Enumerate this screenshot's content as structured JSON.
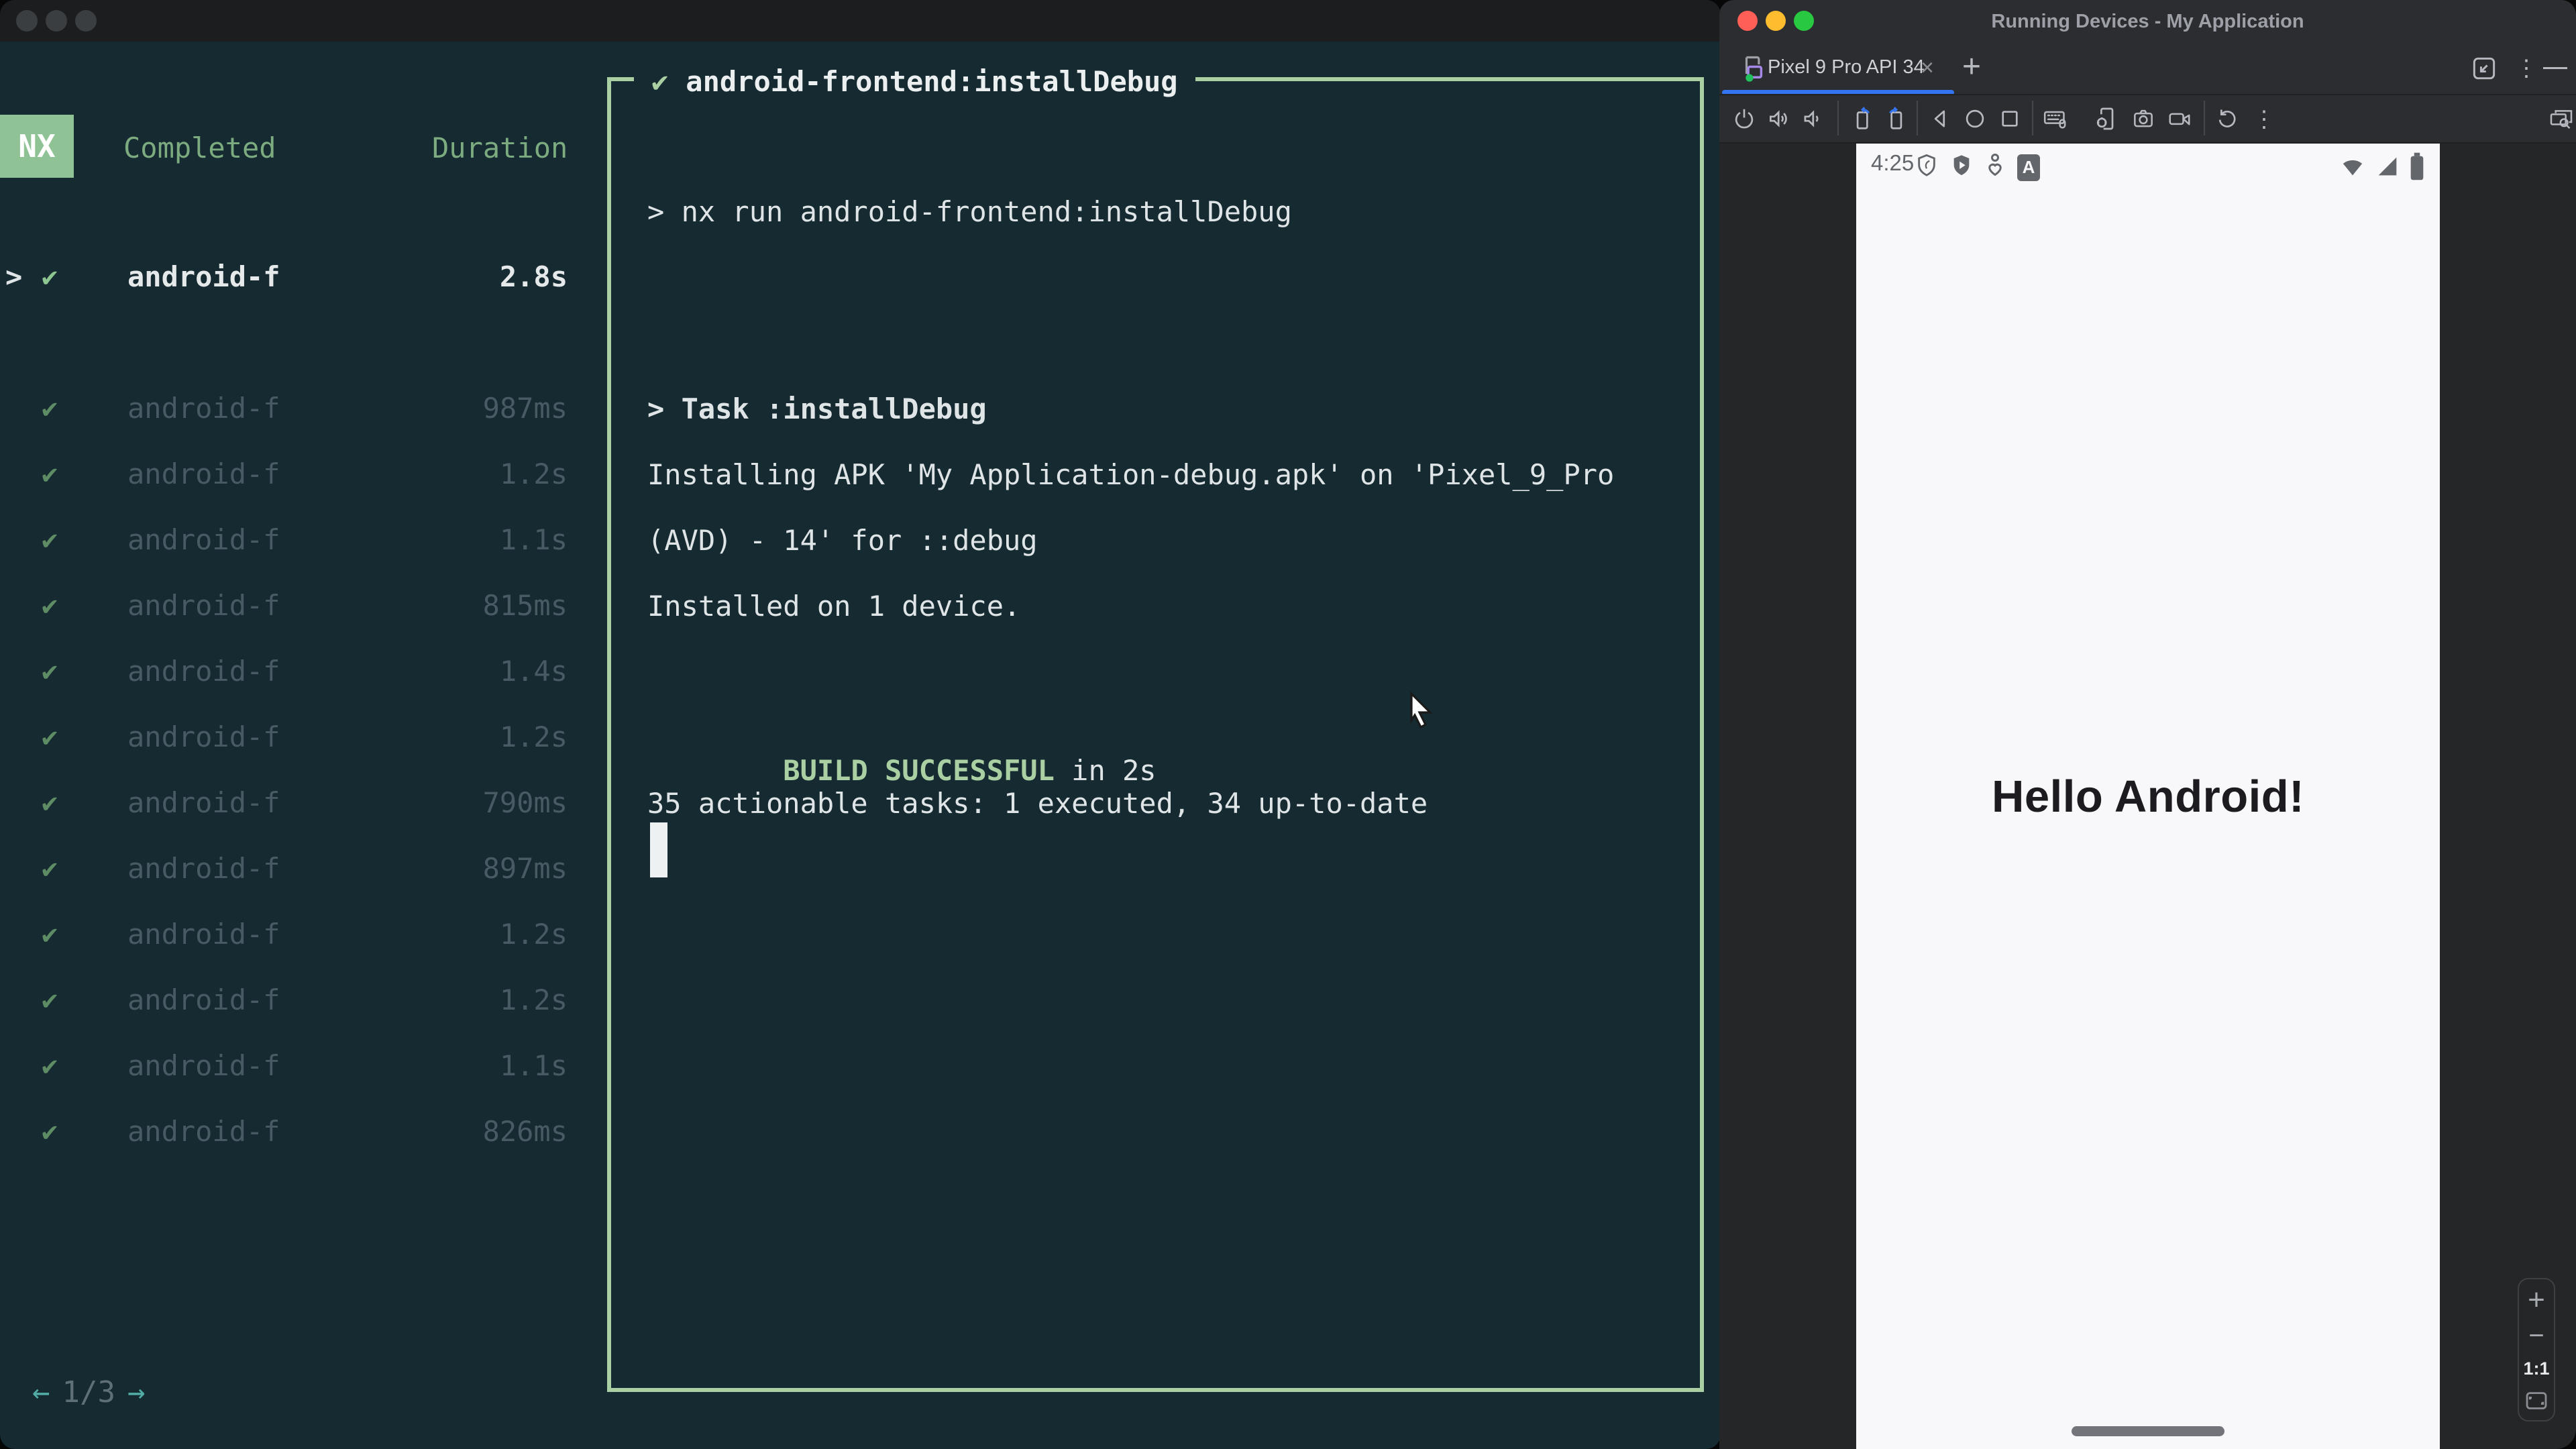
{
  "terminal": {
    "logo": "NX",
    "check_glyph": "✔",
    "chevron_glyph": ">",
    "columns": {
      "completed": "Completed",
      "duration": "Duration"
    },
    "selected_task": {
      "name": "android-f",
      "duration": "2.8s"
    },
    "tasks": [
      {
        "name": "android-f",
        "duration": "987ms"
      },
      {
        "name": "android-f",
        "duration": "1.2s"
      },
      {
        "name": "android-f",
        "duration": "1.1s"
      },
      {
        "name": "android-f",
        "duration": "815ms"
      },
      {
        "name": "android-f",
        "duration": "1.4s"
      },
      {
        "name": "android-f",
        "duration": "1.2s"
      },
      {
        "name": "android-f",
        "duration": "790ms"
      },
      {
        "name": "android-f",
        "duration": "897ms"
      },
      {
        "name": "android-f",
        "duration": "1.2s"
      },
      {
        "name": "android-f",
        "duration": "1.2s"
      },
      {
        "name": "android-f",
        "duration": "1.1s"
      },
      {
        "name": "android-f",
        "duration": "826ms"
      }
    ],
    "pagination": {
      "prev": "←",
      "label": "1/3",
      "next": "→"
    },
    "output": {
      "title": "android-frontend:installDebug",
      "cmd_line": "> nx run android-frontend:installDebug",
      "task_line": "> Task :installDebug",
      "install_line1": "Installing APK 'My Application-debug.apk' on 'Pixel_9_Pro",
      "install_line2": "(AVD) - 14' for ::debug",
      "installed_line": "Installed on 1 device.",
      "build_status": "BUILD SUCCESSFUL",
      "build_suffix": " in 2s",
      "tasks_summary": "35 actionable tasks: 1 executed, 34 up-to-date"
    }
  },
  "studio": {
    "window_title": "Running Devices - My Application",
    "tab": {
      "label": "Pixel 9 Pro API 34",
      "close": "×",
      "add": "+"
    },
    "titlebar_icons": [
      "dock-window-icon",
      "more-vertical-icon",
      "minimize-icon"
    ],
    "toolbar_icons": [
      "power-icon",
      "volume-up-icon",
      "volume-down-icon",
      "rotate-left-icon",
      "rotate-right-icon",
      "back-icon",
      "home-icon",
      "overview-icon",
      "keyboard-icon",
      "device-settings-icon",
      "screenshot-icon",
      "screen-record-icon",
      "reset-icon",
      "more-vertical-icon",
      "displays-search-icon"
    ],
    "more_glyph": "⋮",
    "device": {
      "statusbar": {
        "time": "4:25",
        "a_label": "A",
        "left_icons": [
          "shield-outline-icon",
          "shield-play-icon",
          "wellbeing-icon",
          "a-badge-icon"
        ],
        "right_icons": [
          "wifi-icon",
          "signal-icon",
          "battery-icon"
        ]
      },
      "hello": "Hello Android!",
      "zoom": {
        "in": "+",
        "out": "−",
        "ratio": "1:1"
      }
    }
  },
  "colors": {
    "terminal_bg": "#162a31",
    "green_accent": "#a9cfa3",
    "nx_badge": "#8fc395",
    "studio_bg": "#2b2d30",
    "tab_accent_blue": "#3574f0",
    "device_screen": "#f8f8fb",
    "traffic_red": "#ff5f57",
    "traffic_yellow": "#febc2e",
    "traffic_green": "#28c840"
  }
}
